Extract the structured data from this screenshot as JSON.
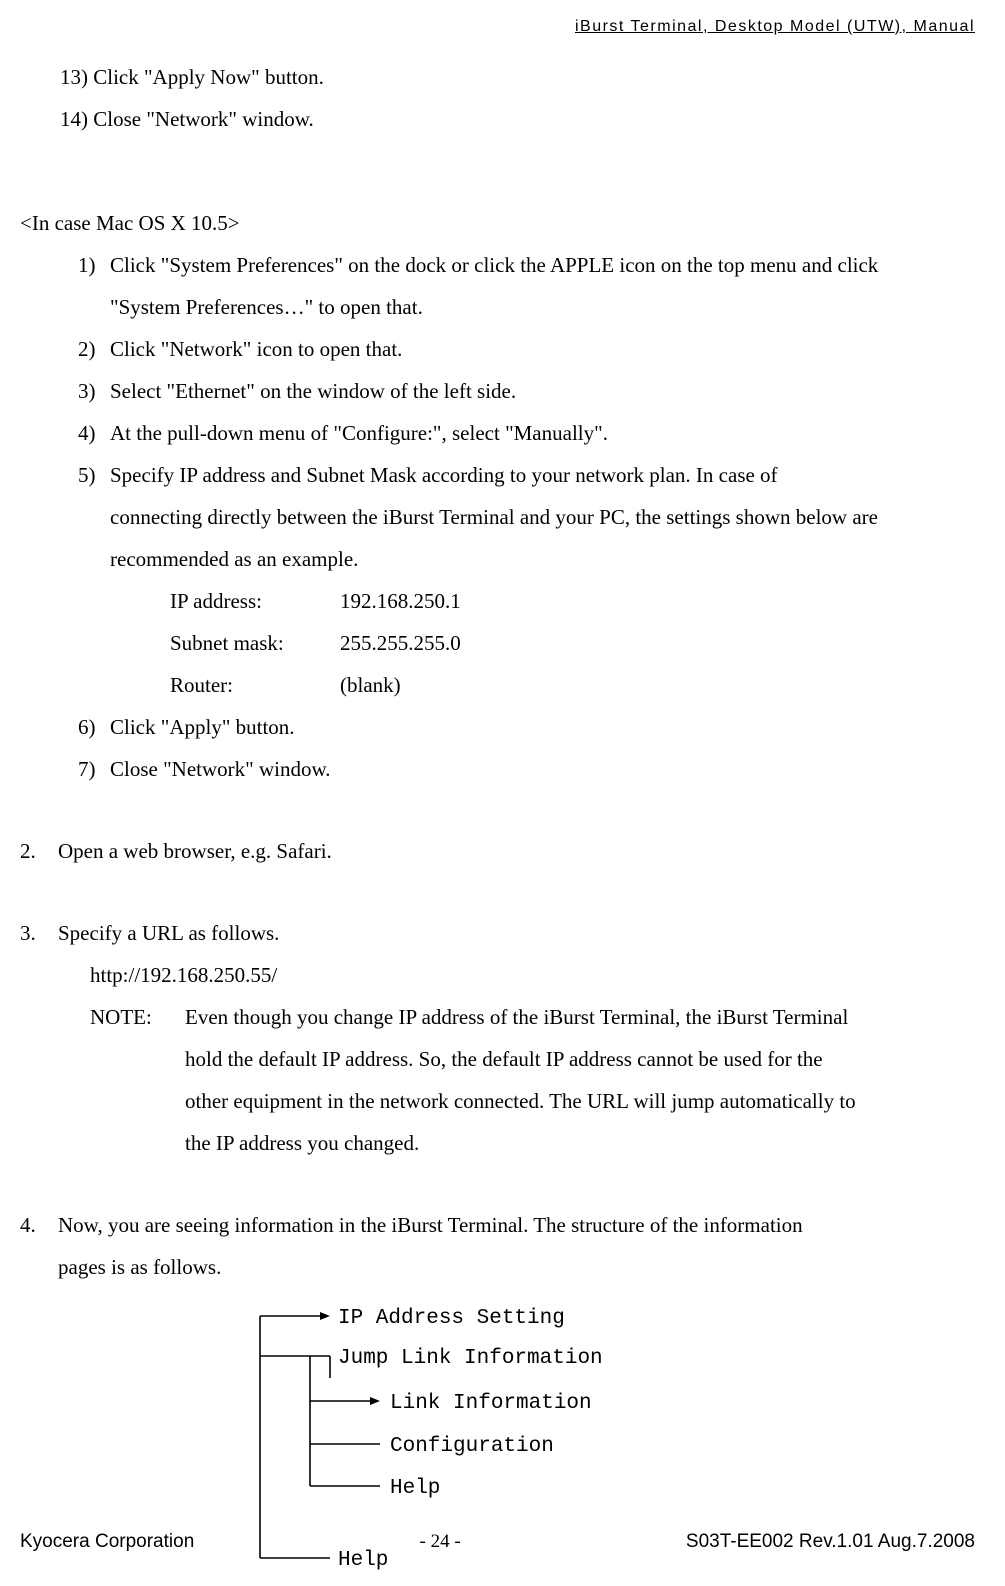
{
  "header": {
    "doc_title": "iBurst  Terminal,  Desktop  Model  (UTW),  Manual"
  },
  "pre_list": {
    "s13": "13) Click \"Apply Now\" button.",
    "s14": "14) Close \"Network\" window."
  },
  "section_case": "<In case Mac OS X 10.5>",
  "steps": {
    "s1a": "Click \"System Preferences\" on the dock or click the APPLE icon on the top menu and click",
    "s1b": "\"System Preferences…\" to open that.",
    "s2": "Click \"Network\" icon to open that.",
    "s3": "Select \"Ethernet\" on the window of the left side.",
    "s4": "At the pull-down menu of \"Configure:\", select \"Manually\".",
    "s5a": "Specify  IP  address  and  Subnet  Mask  according  to  your  network  plan.    In  case  of",
    "s5b": "connecting directly between the iBurst Terminal and your PC, the settings shown below are",
    "s5c": "recommended as an example.",
    "ip_label": "IP address:",
    "ip_val": "192.168.250.1",
    "sm_label": "Subnet mask:",
    "sm_val": "255.255.255.0",
    "rt_label": "Router:",
    "rt_val": "(blank)",
    "s6": "Click \"Apply\" button.",
    "s7": "Close \"Network\" window."
  },
  "nums": {
    "n1": "1)",
    "n2": "2)",
    "n3": "3)",
    "n4": "4)",
    "n5": "5)",
    "n6": "6)",
    "n7": "7)",
    "t2": "2.",
    "t3": "3.",
    "t4": "4."
  },
  "step2": "Open a web browser, e.g. Safari.",
  "step3": {
    "head": "Specify a URL as follows.",
    "url": "http://192.168.250.55/",
    "note_label": "NOTE:",
    "note_l1": "Even though you change IP address of the iBurst Terminal, the iBurst Terminal",
    "note_l2": "hold the default IP address.   So, the default IP address cannot be used for the",
    "note_l3": "other equipment in the network connected.   The URL will jump automatically to",
    "note_l4": "the IP address you changed."
  },
  "step4": {
    "l1": "Now, you are seeing information in the iBurst Terminal.   The structure of the information",
    "l2": "pages is as follows."
  },
  "tree": {
    "n1": "IP Address Setting",
    "n2": "Jump Link Information",
    "n3": "Link Information",
    "n4": "Configuration",
    "n5": "Help",
    "n6": "Help"
  },
  "footer": {
    "company": "Kyocera Corporation",
    "page": "- 24 -",
    "rev": "S03T-EE002 Rev.1.01 Aug.7.2008"
  }
}
